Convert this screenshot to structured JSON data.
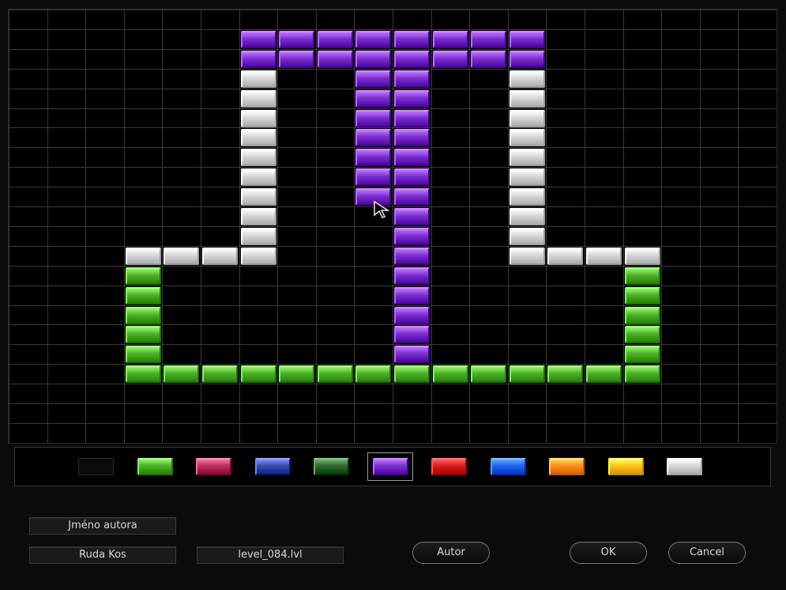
{
  "grid": {
    "cols": 20,
    "rows": 22
  },
  "colors": {
    "black": "#0a0a0a",
    "green": "#4fb02a",
    "pink": "#b8305e",
    "blue": "#3a4cb0",
    "darkgreen": "#2e6a2e",
    "purple": "#7a2fcf",
    "red": "#d81c1c",
    "brightblue": "#1f62f0",
    "orange": "#ff8c1a",
    "yellow": "#ffc21a",
    "white": "#d6d6d6"
  },
  "bricks": [
    {
      "color": "purple",
      "cells": [
        [
          6,
          1
        ],
        [
          7,
          1
        ],
        [
          8,
          1
        ],
        [
          9,
          1
        ],
        [
          10,
          1
        ],
        [
          11,
          1
        ],
        [
          12,
          1
        ],
        [
          13,
          1
        ],
        [
          6,
          2
        ],
        [
          7,
          2
        ],
        [
          8,
          2
        ],
        [
          9,
          2
        ],
        [
          10,
          2
        ],
        [
          11,
          2
        ],
        [
          12,
          2
        ],
        [
          13,
          2
        ],
        [
          9,
          3
        ],
        [
          10,
          3
        ],
        [
          9,
          4
        ],
        [
          10,
          4
        ],
        [
          9,
          5
        ],
        [
          10,
          5
        ],
        [
          9,
          6
        ],
        [
          10,
          6
        ],
        [
          9,
          7
        ],
        [
          10,
          7
        ],
        [
          9,
          8
        ],
        [
          10,
          8
        ],
        [
          9,
          9
        ],
        [
          10,
          9
        ],
        [
          10,
          10
        ],
        [
          10,
          11
        ],
        [
          10,
          12
        ],
        [
          10,
          13
        ],
        [
          10,
          14
        ],
        [
          10,
          15
        ],
        [
          10,
          16
        ],
        [
          10,
          17
        ]
      ]
    },
    {
      "color": "white",
      "cells": [
        [
          6,
          3
        ],
        [
          6,
          4
        ],
        [
          6,
          5
        ],
        [
          6,
          6
        ],
        [
          6,
          7
        ],
        [
          6,
          8
        ],
        [
          6,
          9
        ],
        [
          6,
          10
        ],
        [
          6,
          11
        ],
        [
          13,
          3
        ],
        [
          13,
          4
        ],
        [
          13,
          5
        ],
        [
          13,
          6
        ],
        [
          13,
          7
        ],
        [
          13,
          8
        ],
        [
          13,
          9
        ],
        [
          13,
          10
        ],
        [
          13,
          11
        ],
        [
          3,
          12
        ],
        [
          4,
          12
        ],
        [
          5,
          12
        ],
        [
          6,
          12
        ],
        [
          13,
          12
        ],
        [
          14,
          12
        ],
        [
          15,
          12
        ],
        [
          16,
          12
        ]
      ]
    },
    {
      "color": "green",
      "cells": [
        [
          3,
          13
        ],
        [
          3,
          14
        ],
        [
          3,
          15
        ],
        [
          3,
          16
        ],
        [
          3,
          17
        ],
        [
          16,
          13
        ],
        [
          16,
          14
        ],
        [
          16,
          15
        ],
        [
          16,
          16
        ],
        [
          16,
          17
        ],
        [
          3,
          18
        ],
        [
          4,
          18
        ],
        [
          5,
          18
        ],
        [
          6,
          18
        ],
        [
          7,
          18
        ],
        [
          8,
          18
        ],
        [
          9,
          18
        ],
        [
          10,
          18
        ],
        [
          11,
          18
        ],
        [
          12,
          18
        ],
        [
          13,
          18
        ],
        [
          14,
          18
        ],
        [
          15,
          18
        ],
        [
          16,
          18
        ]
      ]
    }
  ],
  "palette": {
    "swatches": [
      "black",
      "green",
      "pink",
      "blue",
      "darkgreen",
      "purple",
      "red",
      "brightblue",
      "orange",
      "yellow",
      "white"
    ],
    "selected": "purple"
  },
  "author": {
    "label": "Jméno  autora",
    "name": "Ruda  Kos",
    "filename": "level_084.lvl"
  },
  "buttons": {
    "autor": "Autor",
    "ok": "OK",
    "cancel": "Cancel"
  }
}
